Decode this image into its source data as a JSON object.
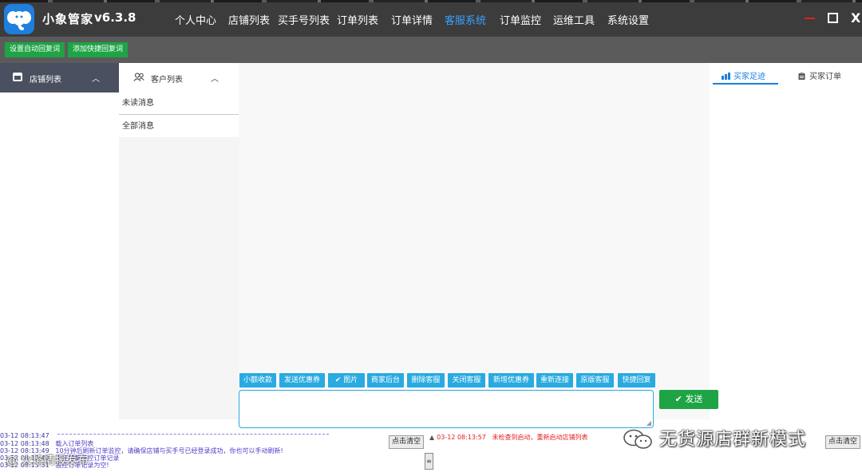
{
  "app": {
    "name": "小象管家",
    "version": "v6.3.8"
  },
  "menu": [
    {
      "label": "个人中心"
    },
    {
      "label": "店铺列表"
    },
    {
      "label": "买手号列表"
    },
    {
      "label": "订单列表"
    },
    {
      "label": "订单详情"
    },
    {
      "label": "客服系统",
      "active": true
    },
    {
      "label": "订单监控"
    },
    {
      "label": "运维工具"
    },
    {
      "label": "系统设置"
    }
  ],
  "window_controls": {
    "minimize": "—",
    "maximize": "口",
    "close": "X"
  },
  "toolbar": {
    "auto_reply": "设置自动回复词",
    "quick_reply": "添加快捷回复词"
  },
  "shop_panel": {
    "title": "店铺列表",
    "chevron": "︿"
  },
  "customer_panel": {
    "title": "客户列表",
    "chevron": "︿",
    "items": [
      {
        "label": "未读消息"
      },
      {
        "label": "全部消息"
      }
    ]
  },
  "right_panel": {
    "tabs": [
      {
        "label": "买家足迹",
        "active": true
      },
      {
        "label": "买家订单"
      }
    ]
  },
  "quick_buttons": [
    {
      "label": "小额收款"
    },
    {
      "label": "发送优惠券"
    },
    {
      "label": "✔ 图片"
    },
    {
      "label": "商家后台"
    },
    {
      "label": "删除客服"
    },
    {
      "label": "关闭客服"
    },
    {
      "label": "新增优惠券"
    },
    {
      "label": "重新连接"
    },
    {
      "label": "原版客服"
    },
    {
      "label": "快捷回复"
    }
  ],
  "send_button": "✔ 发送",
  "log_left": [
    {
      "ts": "03-12 08:13:47",
      "text": ""
    },
    {
      "ts": "03-12 08:13:48",
      "text": "载入订单列表"
    },
    {
      "ts": "03-12 08:13:49",
      "text": "10分钟后刷新订单监控，请确保店铺与买手号已经登录成功，你也可以手动刷新!"
    },
    {
      "ts": "03-12 08:13:49",
      "text": "正在加载监控订单记录"
    },
    {
      "ts": "03-12 08:13:51",
      "text": "监控订单记录为空!"
    }
  ],
  "log_right": {
    "ts": "03-12 08:13:57",
    "text": "未检查到启动，重新启动店铺列表"
  },
  "clear_button": "点击清空",
  "watermark": {
    "text": "无货源店群新模式",
    "small": "@ 火焰情报发布"
  },
  "colors": {
    "title_bar": "#3c3c3c",
    "toolbar": "#5b5b5b",
    "green": "#1ea345",
    "accent_blue": "#29aae1",
    "active_menu": "#3aa0ff",
    "log_purple": "#5040c8",
    "log_red": "#e0201e"
  },
  "icons": {
    "logo": "elephant-logo-icon",
    "shop": "shop-icon",
    "customers": "customers-icon",
    "footprint": "footprint-icon",
    "orders": "clipboard-icon",
    "wechat": "wechat-logo-icon"
  }
}
